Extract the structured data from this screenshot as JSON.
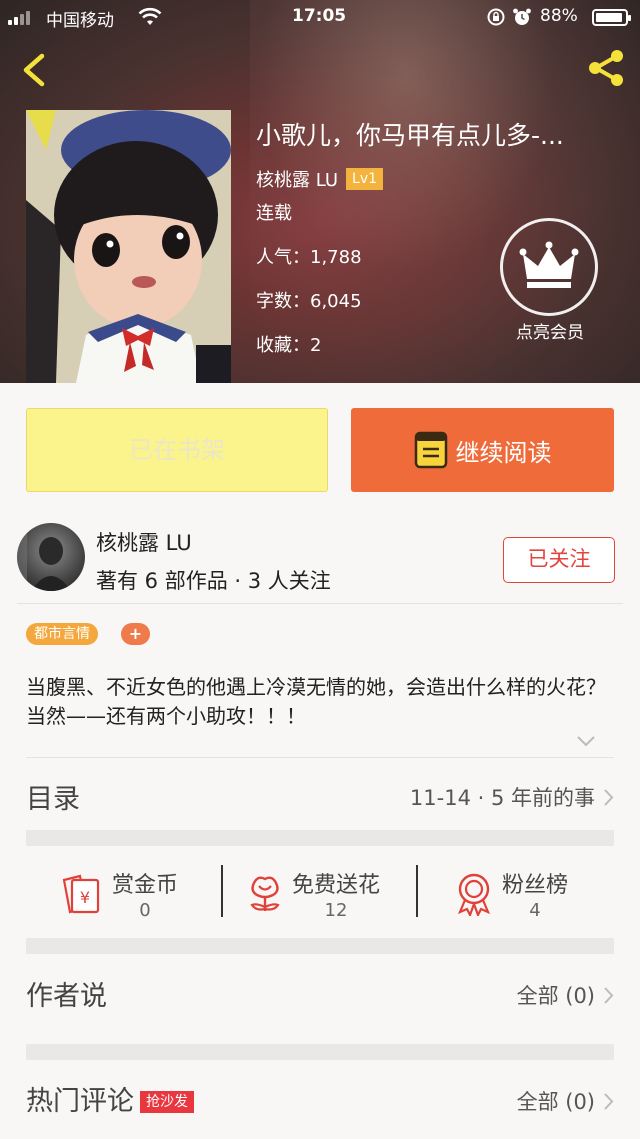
{
  "status_bar": {
    "carrier": "中国移动",
    "time": "17:05",
    "battery": "88%",
    "battery_level": 0.88
  },
  "book": {
    "title": "小歌儿，你马甲有点儿多-...",
    "author": "核桃露 LU",
    "author_level": "Lv1",
    "status": "连载",
    "popularity": "人气：1,788",
    "word_count": "字数：6,045",
    "favorites": "收藏：2"
  },
  "vip": {
    "label": "点亮会员"
  },
  "actions": {
    "shelf_label": "已在书架",
    "read_label": "继续阅读"
  },
  "author_card": {
    "name": "核桃露 LU",
    "works": "著有 6 部作品 · 3 人关注",
    "follow_label": "已关注"
  },
  "tags": {
    "genre": "都市言情",
    "add": "+"
  },
  "synopsis": "当腹黑、不近女色的他遇上冷漠无情的她，会造出什么样的火花？当然——还有两个小助攻！！！",
  "catalog": {
    "label": "目录",
    "latest": "11-14 · 5 年前的事"
  },
  "gifts": [
    {
      "name": "赏金币",
      "count": "0"
    },
    {
      "name": "免费送花",
      "count": "12"
    },
    {
      "name": "粉丝榜",
      "count": "4"
    }
  ],
  "author_says": {
    "label": "作者说",
    "all": "全部 (0)"
  },
  "hot_comments": {
    "label": "热门评论",
    "badge": "抢沙发",
    "all": "全部 (0)"
  },
  "colors": {
    "accent_orange": "#ef6b3a",
    "shelf_yellow": "#fbf48c",
    "follow_red": "#e3443c",
    "tag_orange": "#f4a73c"
  }
}
